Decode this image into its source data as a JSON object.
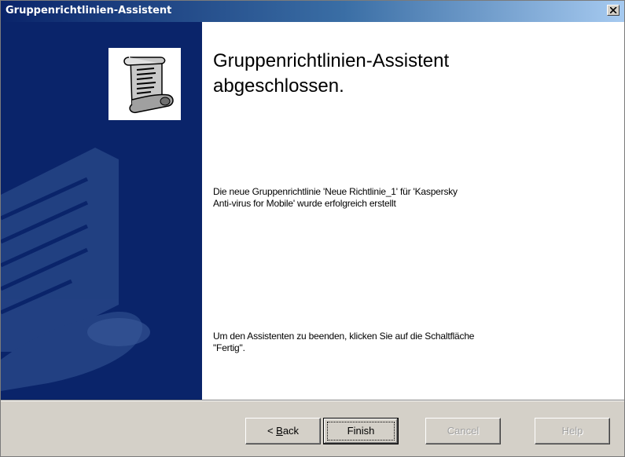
{
  "window": {
    "title": "Gruppenrichtlinien-Assistent",
    "title_bar_color": "#0a246a",
    "sidebar_color": "#0a246a"
  },
  "heading": {
    "line1": "Gruppenrichtlinien-Assistent",
    "line2": "abgeschlossen."
  },
  "messages": {
    "created_line1": "Die neue Gruppenrichtlinie 'Neue Richtlinie_1' für 'Kaspersky",
    "created_line2": "Anti-virus for Mobile' wurde erfolgreich erstellt",
    "finish_line1": "Um den Assistenten zu beenden, klicken Sie auf die Schaltfläche",
    "finish_line2": "\"Fertig\"."
  },
  "buttons": {
    "back_prefix": "< ",
    "back_mnemonic": "B",
    "back_rest": "ack",
    "finish": "Finish",
    "cancel": "Cancel",
    "help": "Help"
  },
  "icons": {
    "wizard": "scroll-document-icon",
    "close": "close-icon"
  }
}
